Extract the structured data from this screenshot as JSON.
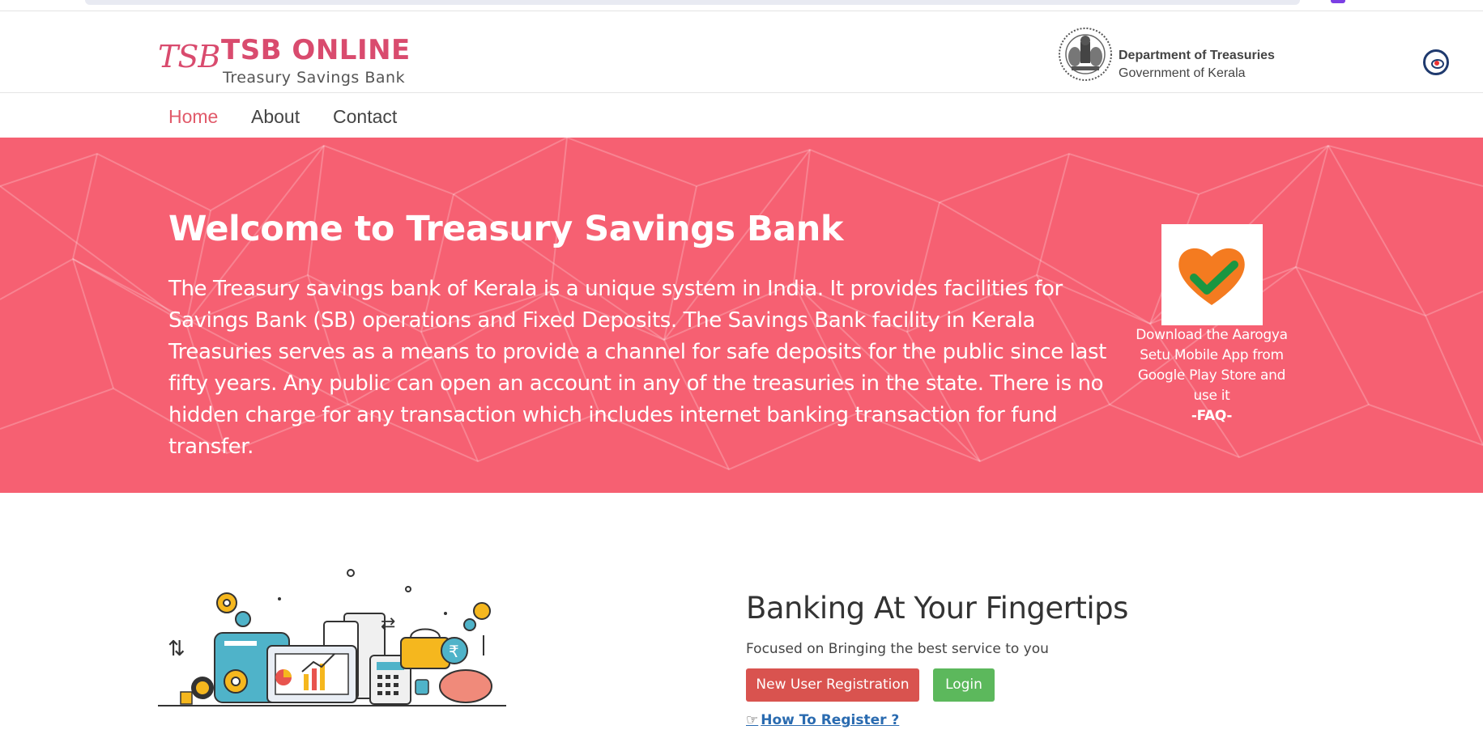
{
  "header": {
    "logo_script": "TSB",
    "logo_title": "TSB ONLINE",
    "logo_subtitle": "Treasury Savings Bank",
    "dept_title": "Department of Treasuries",
    "dept_subtitle": "Government of Kerala"
  },
  "nav": {
    "items": [
      {
        "label": "Home",
        "active": true
      },
      {
        "label": "About",
        "active": false
      },
      {
        "label": "Contact",
        "active": false
      }
    ]
  },
  "hero": {
    "heading": "Welcome to Treasury Savings Bank",
    "body": "The Treasury savings bank of Kerala is a unique system in India. It provides facilities for Savings Bank (SB) operations and Fixed Deposits. The Savings Bank facility in Kerala Treasuries serves as a means to provide a channel for safe deposits for the public since last fifty years. Any public can open an account in any of the treasuries in the state. There is no hidden charge for any transaction which includes internet banking transaction for fund transfer.",
    "app_text": "Download the Aarogya Setu Mobile App from Google Play Store and use it",
    "faq_label": "-FAQ-"
  },
  "banking": {
    "heading": "Banking At Your Fingertips",
    "tagline": "Focused on Bringing the best service to you",
    "register_button": "New User Registration",
    "login_button": "Login",
    "howto_link": "How To Register ?",
    "howto_icon": "pointing-hand-icon"
  },
  "colors": {
    "hero_bg": "#f66072",
    "brand": "#d94b6e",
    "nav_active": "#e15a6a",
    "register_btn": "#d9534f",
    "login_btn": "#5cb85c",
    "link": "#2a6bb0"
  }
}
